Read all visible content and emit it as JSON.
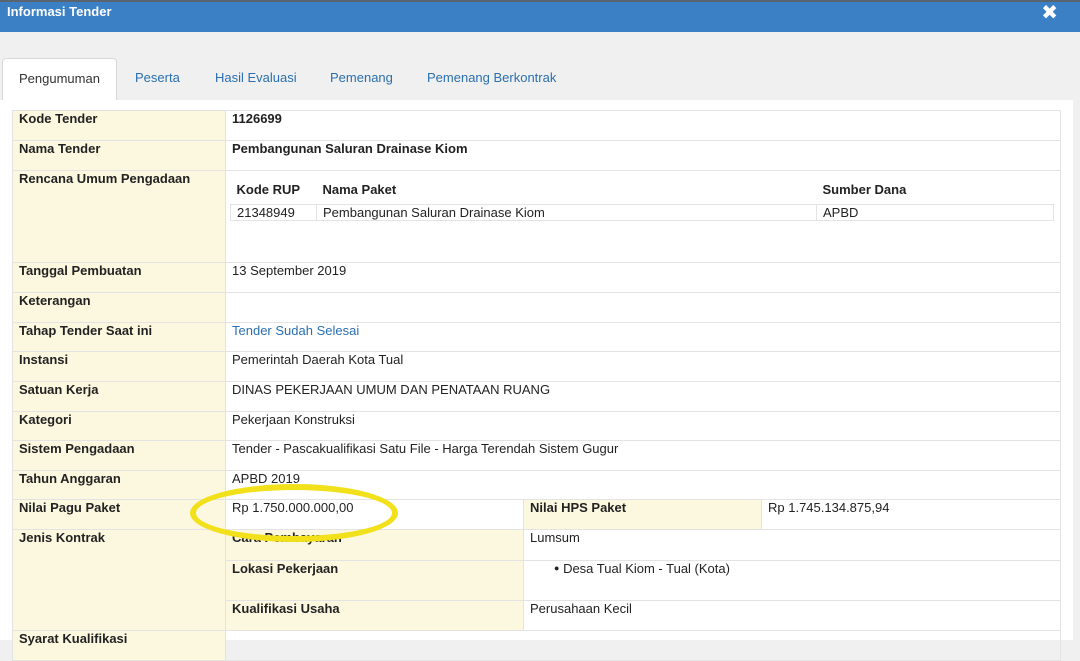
{
  "window": {
    "title": "Informasi Tender",
    "close_icon": "close-icon"
  },
  "tabs": [
    {
      "label": "Pengumuman",
      "active": true
    },
    {
      "label": "Peserta"
    },
    {
      "label": "Hasil Evaluasi"
    },
    {
      "label": "Pemenang"
    },
    {
      "label": "Pemenang Berkontrak"
    }
  ],
  "info": {
    "kode_tender": {
      "label": "Kode Tender",
      "value": "1126699"
    },
    "nama_tender": {
      "label": "Nama Tender",
      "value": "Pembangunan Saluran Drainase Kiom"
    },
    "rup": {
      "label": "Rencana Umum Pengadaan",
      "headers": [
        "Kode RUP",
        "Nama Paket",
        "Sumber Dana"
      ],
      "rows": [
        [
          "21348949",
          "Pembangunan Saluran Drainase Kiom",
          "APBD"
        ]
      ]
    },
    "tanggal": {
      "label": "Tanggal Pembuatan",
      "value": "13 September 2019"
    },
    "keterangan": {
      "label": "Keterangan",
      "value": ""
    },
    "tahap": {
      "label": "Tahap Tender Saat ini",
      "value": "Tender Sudah Selesai"
    },
    "instansi": {
      "label": "Instansi",
      "value": "Pemerintah Daerah Kota Tual"
    },
    "satuan_kerja": {
      "label": "Satuan Kerja",
      "value": "DINAS PEKERJAAN UMUM DAN PENATAAN RUANG"
    },
    "kategori": {
      "label": "Kategori",
      "value": "Pekerjaan Konstruksi"
    },
    "sistem": {
      "label": "Sistem Pengadaan",
      "value": "Tender - Pascakualifikasi Satu File - Harga Terendah Sistem Gugur"
    },
    "tahun": {
      "label": "Tahun Anggaran",
      "value": "APBD 2019"
    },
    "pagu": {
      "label": "Nilai Pagu Paket",
      "value": "Rp 1.750.000.000,00"
    },
    "hps": {
      "label": "Nilai HPS Paket",
      "value": "Rp 1.745.134.875,94"
    },
    "jenis_kontrak": {
      "label": "Jenis Kontrak"
    },
    "cara_pembayaran": {
      "label": "Cara Pembayaran",
      "value": "Lumsum"
    },
    "lokasi": {
      "label": "Lokasi Pekerjaan",
      "value": "Desa Tual Kiom - Tual (Kota)"
    },
    "kualifikasi": {
      "label": "Kualifikasi Usaha",
      "value": "Perusahaan Kecil"
    },
    "syarat": {
      "label": "Syarat Kualifikasi"
    }
  },
  "colors": {
    "header": "#3b7fc4",
    "label_bg": "#fcf8e0",
    "link": "#2a6fb1",
    "highlight": "#f1e01a"
  }
}
